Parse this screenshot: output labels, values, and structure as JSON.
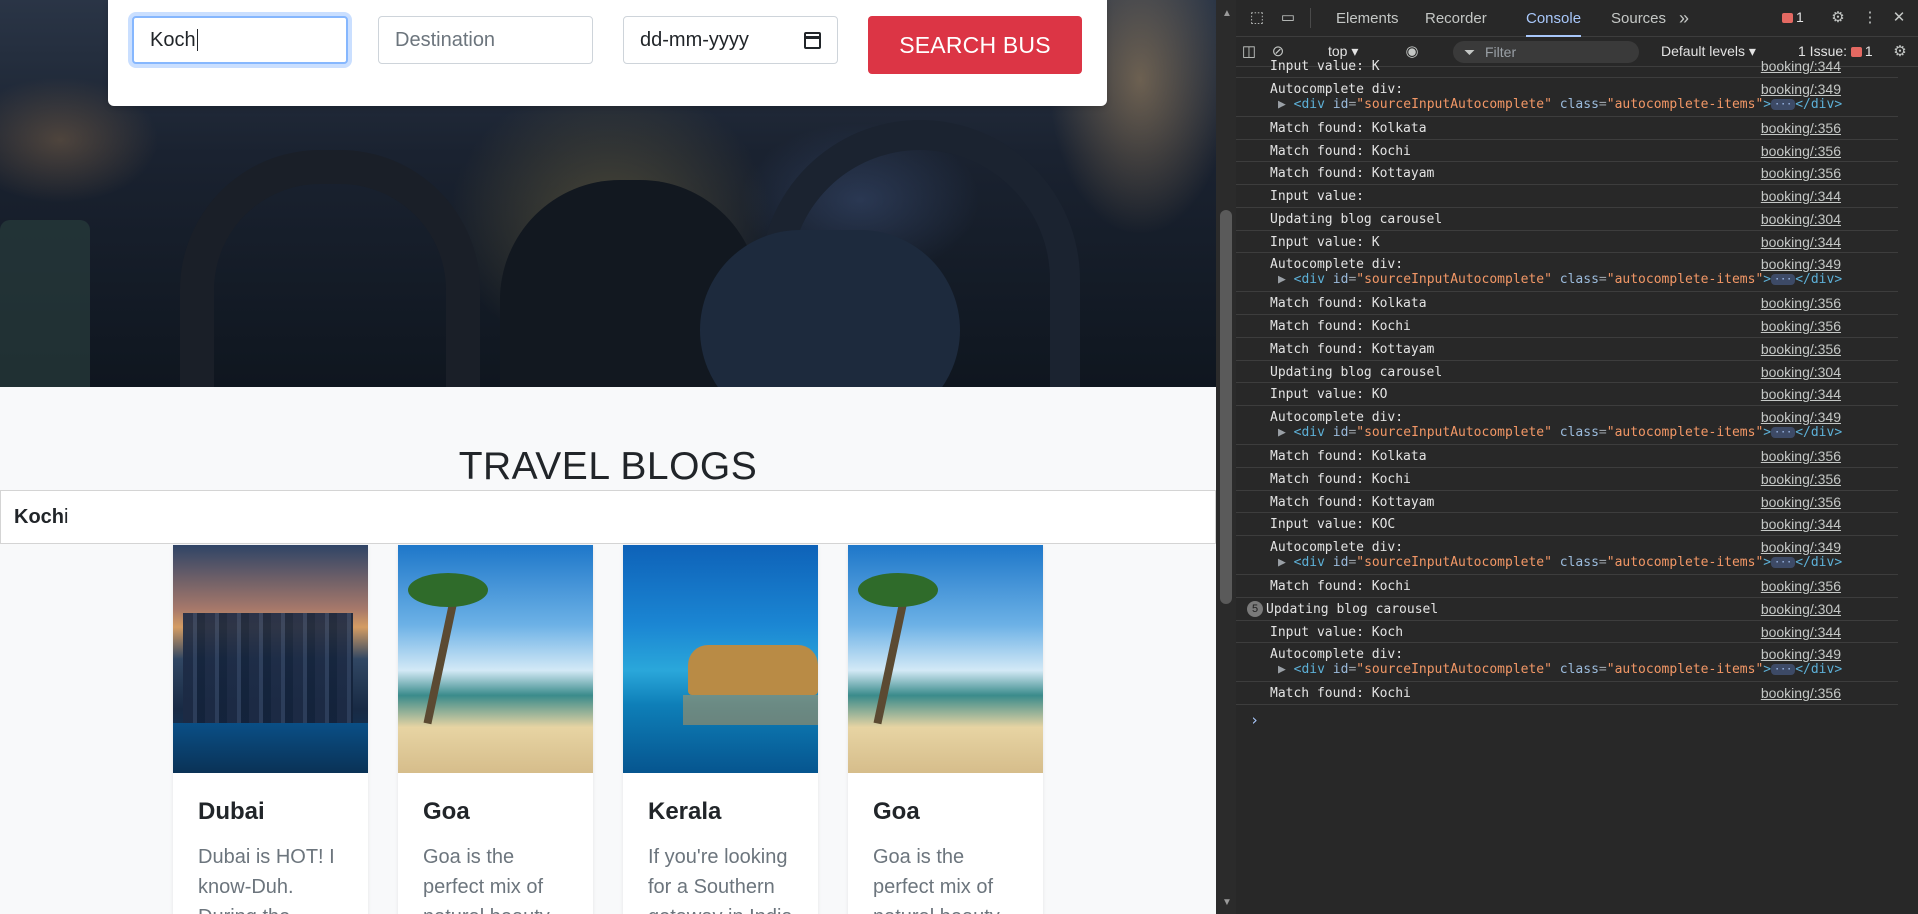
{
  "search": {
    "source_value": "Koch",
    "destination_placeholder": "Destination",
    "date_placeholder": "dd-mm-yyyy",
    "button_label": "SEARCH BUS"
  },
  "blogs": {
    "heading": "TRAVEL BLOGS",
    "autocomplete": {
      "match": "Koch",
      "rest": "i"
    },
    "cards": [
      {
        "name": "Dubai",
        "text": "Dubai is HOT! I know-Duh. During the",
        "image": "dubai-skyline"
      },
      {
        "name": "Goa",
        "text": "Goa is the perfect mix of natural beauty",
        "image": "goa-beach"
      },
      {
        "name": "Kerala",
        "text": "If you're looking for a Southern getaway in India",
        "image": "kerala-houseboat"
      },
      {
        "name": "Goa",
        "text": "Goa is the perfect mix of natural beauty",
        "image": "goa-beach"
      }
    ]
  },
  "devtools": {
    "tabs": [
      "Elements",
      "Recorder",
      "Console",
      "Sources"
    ],
    "active_tab": "Console",
    "more_tabs": "»",
    "error_count": "1",
    "context": "top",
    "filter_placeholder": "Filter",
    "levels": "Default levels",
    "issues_label": "1 Issue:",
    "issues_count": "1",
    "console": [
      {
        "type": "msg",
        "text": "Input value: K",
        "src": "booking/:344"
      },
      {
        "type": "el",
        "text": "Autocomplete div:",
        "src": "booking/:349",
        "el_id": "sourceInputAutocomplete",
        "el_class": "autocomplete-items"
      },
      {
        "type": "msg",
        "text": "Match found: Kolkata",
        "src": "booking/:356"
      },
      {
        "type": "msg",
        "text": "Match found: Kochi",
        "src": "booking/:356"
      },
      {
        "type": "msg",
        "text": "Match found: Kottayam",
        "src": "booking/:356"
      },
      {
        "type": "msg",
        "text": "Input value:",
        "src": "booking/:344"
      },
      {
        "type": "msg",
        "text": "Updating blog carousel",
        "src": "booking/:304"
      },
      {
        "type": "msg",
        "text": "Input value: K",
        "src": "booking/:344"
      },
      {
        "type": "el",
        "text": "Autocomplete div:",
        "src": "booking/:349",
        "el_id": "sourceInputAutocomplete",
        "el_class": "autocomplete-items"
      },
      {
        "type": "msg",
        "text": "Match found: Kolkata",
        "src": "booking/:356"
      },
      {
        "type": "msg",
        "text": "Match found: Kochi",
        "src": "booking/:356"
      },
      {
        "type": "msg",
        "text": "Match found: Kottayam",
        "src": "booking/:356"
      },
      {
        "type": "msg",
        "text": "Updating blog carousel",
        "src": "booking/:304"
      },
      {
        "type": "msg",
        "text": "Input value: KO",
        "src": "booking/:344"
      },
      {
        "type": "el",
        "text": "Autocomplete div:",
        "src": "booking/:349",
        "el_id": "sourceInputAutocomplete",
        "el_class": "autocomplete-items"
      },
      {
        "type": "msg",
        "text": "Match found: Kolkata",
        "src": "booking/:356"
      },
      {
        "type": "msg",
        "text": "Match found: Kochi",
        "src": "booking/:356"
      },
      {
        "type": "msg",
        "text": "Match found: Kottayam",
        "src": "booking/:356"
      },
      {
        "type": "msg",
        "text": "Input value: KOC",
        "src": "booking/:344"
      },
      {
        "type": "el",
        "text": "Autocomplete div:",
        "src": "booking/:349",
        "el_id": "sourceInputAutocomplete",
        "el_class": "autocomplete-items"
      },
      {
        "type": "msg",
        "text": "Match found: Kochi",
        "src": "booking/:356"
      },
      {
        "type": "msg",
        "text": "Updating blog carousel",
        "src": "booking/:304",
        "repeat": "5"
      },
      {
        "type": "msg",
        "text": "Input value: Koch",
        "src": "booking/:344"
      },
      {
        "type": "el",
        "text": "Autocomplete div:",
        "src": "booking/:349",
        "el_id": "sourceInputAutocomplete",
        "el_class": "autocomplete-items"
      },
      {
        "type": "msg",
        "text": "Match found: Kochi",
        "src": "booking/:356"
      }
    ],
    "prompt": "›"
  },
  "colors": {
    "search_button": "#dc3545",
    "console_bg": "#282828",
    "link_blue": "#a8c7fa"
  }
}
